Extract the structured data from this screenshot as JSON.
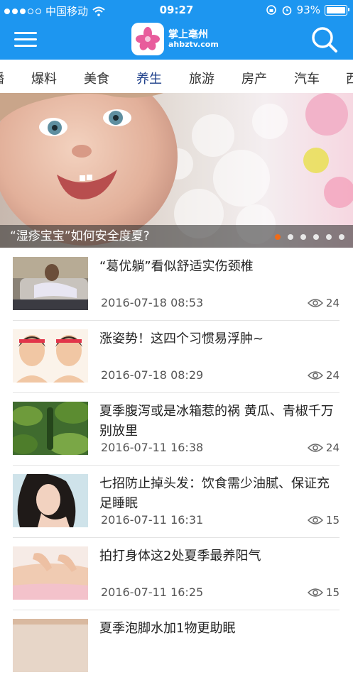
{
  "status_bar": {
    "carrier": "中国移动",
    "time": "09:27",
    "battery": "93%"
  },
  "header": {
    "app_name_cn": "掌上亳州",
    "app_name_en": "ahbztv.com"
  },
  "tabs": [
    {
      "label": "播"
    },
    {
      "label": "爆料"
    },
    {
      "label": "美食"
    },
    {
      "label": "养生",
      "active": true
    },
    {
      "label": "旅游"
    },
    {
      "label": "房产"
    },
    {
      "label": "汽车"
    },
    {
      "label": "西"
    }
  ],
  "banner": {
    "caption": "“湿疹宝宝”如何安全度夏?",
    "pages": 6,
    "current_page": 1
  },
  "articles": [
    {
      "title": "“葛优躺”看似舒适实伤颈椎",
      "date": "2016-07-18 08:53",
      "views": "24",
      "thumb": "person-lying-on-sofa"
    },
    {
      "title": "涨姿势！这四个习惯易浮肿~",
      "date": "2016-07-18 08:29",
      "views": "24",
      "thumb": "face-massage-illustration"
    },
    {
      "title": "夏季腹泻或是冰箱惹的祸 黄瓜、青椒千万别放里",
      "date": "2016-07-11 16:38",
      "views": "24",
      "thumb": "cucumber-plant"
    },
    {
      "title": "七招防止掉头发：饮食需少油腻、保证充足睡眠",
      "date": "2016-07-11 16:31",
      "views": "15",
      "thumb": "woman-long-hair"
    },
    {
      "title": "拍打身体这2处夏季最养阳气",
      "date": "2016-07-11 16:25",
      "views": "15",
      "thumb": "back-massage"
    },
    {
      "title": "夏季泡脚水加1物更助眠",
      "date": "",
      "views": "",
      "thumb": "partial-thumb"
    }
  ],
  "colors": {
    "brand_blue": "#1d96f0",
    "active_tab": "#1d3f8a",
    "pager_active": "#f06a17"
  }
}
